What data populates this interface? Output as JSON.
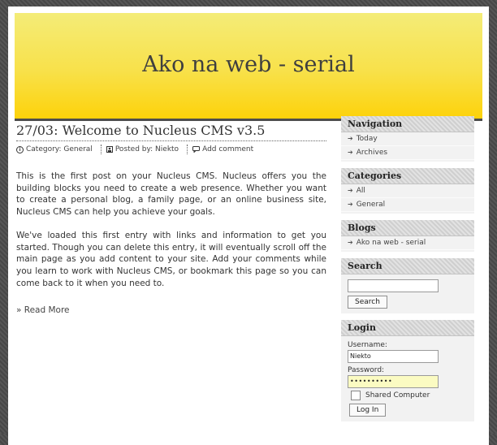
{
  "site": {
    "title": "Ako na web - serial"
  },
  "post": {
    "title": "27/03: Welcome to Nucleus CMS v3.5",
    "meta": {
      "category": "Category: General",
      "posted_by": "Posted by: Niekto",
      "add_comment": "Add comment"
    },
    "paragraphs": [
      "This is the first post on your Nucleus CMS. Nucleus offers you the building blocks you need to create a web presence. Whether you want to create a personal blog, a family page, or an online business site, Nucleus CMS can help you achieve your goals.",
      "We've loaded this first entry with links and information to get you started. Though you can delete this entry, it will eventually scroll off the main page as you add content to your site. Add your comments while you learn to work with Nucleus CMS, or bookmark this page so you can come back to it when you need to."
    ],
    "read_more": "» Read More"
  },
  "sidebar": {
    "navigation": {
      "title": "Navigation",
      "items": [
        "Today",
        "Archives"
      ]
    },
    "categories": {
      "title": "Categories",
      "items": [
        "All",
        "General"
      ]
    },
    "blogs": {
      "title": "Blogs",
      "items": [
        "Ako na web - serial"
      ]
    },
    "search": {
      "title": "Search",
      "value": "",
      "button": "Search"
    },
    "login": {
      "title": "Login",
      "username_label": "Username:",
      "username_value": "Niekto",
      "password_label": "Password:",
      "password_value": "••••••••••",
      "shared_label": "Shared Computer",
      "button": "Log In"
    }
  }
}
